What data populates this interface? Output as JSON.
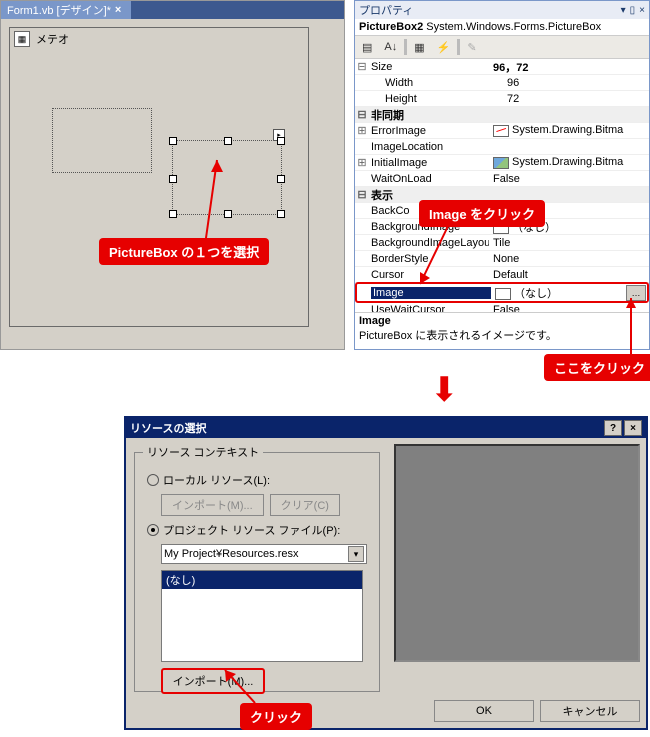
{
  "designer": {
    "tab_label": "Form1.vb [デザイン]*",
    "form_title": "メテオ"
  },
  "callouts": {
    "select_pb": "PictureBox の１つを選択",
    "click_image": "Image をクリック",
    "click_here": "ここをクリック",
    "click_import": "クリック"
  },
  "props": {
    "panel_title": "プロパティ",
    "object": "PictureBox2",
    "object_type": "System.Windows.Forms.PictureBox",
    "rows": {
      "size_label": "Size",
      "size_val": "96，72",
      "width_label": "Width",
      "width_val": "96",
      "height_label": "Height",
      "height_val": "72",
      "async_label": "非同期",
      "errimg_label": "ErrorImage",
      "errimg_val": "System.Drawing.Bitma",
      "imgloc_label": "ImageLocation",
      "imgloc_val": "",
      "initimg_label": "InitialImage",
      "initimg_val": "System.Drawing.Bitma",
      "waitload_label": "WaitOnLoad",
      "waitload_val": "False",
      "disp_label": "表示",
      "backcol_label": "BackCo",
      "backcol_val": "",
      "bgi_label": "BackgroundImage",
      "bgi_val": "（なし）",
      "bgil_label": "BackgroundImageLayout",
      "bgil_val": "Tile",
      "border_label": "BorderStyle",
      "border_val": "None",
      "cursor_label": "Cursor",
      "cursor_val": "Default",
      "image_label": "Image",
      "image_val": "（なし）",
      "usewc_label": "UseWaitCursor",
      "usewc_val": "False"
    },
    "desc_name": "Image",
    "desc_text": "PictureBox に表示されるイメージです。"
  },
  "dialog": {
    "title": "リソースの選択",
    "group": "リソース コンテキスト",
    "local_radio": "ローカル リソース(L):",
    "import_btn": "インポート(M)...",
    "clear_btn": "クリア(C)",
    "project_radio": "プロジェクト リソース ファイル(P):",
    "combo_value": "My Project¥Resources.resx",
    "list_none": "(なし)",
    "import2_btn": "インポート(M)...",
    "ok": "OK",
    "cancel": "キャンセル"
  }
}
